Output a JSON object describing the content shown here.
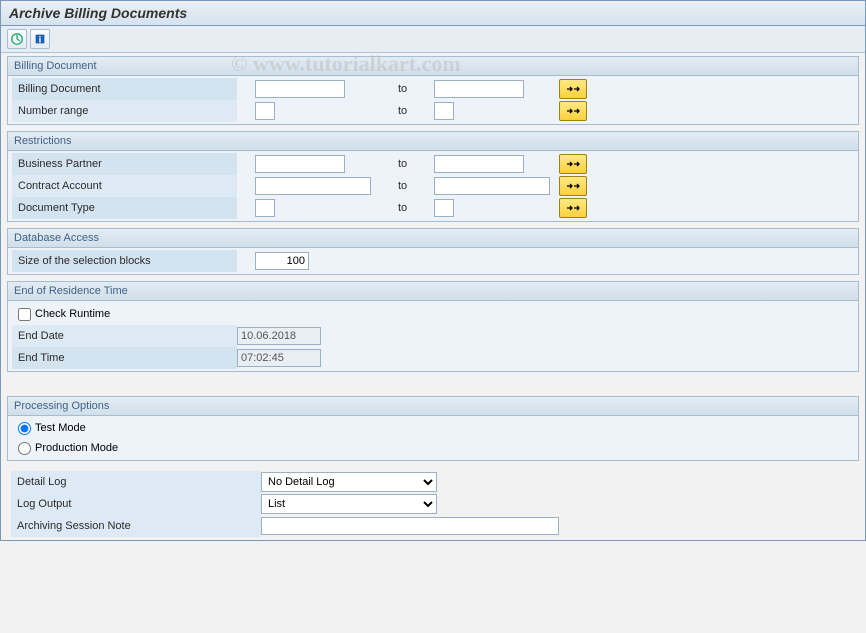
{
  "title": "Archive Billing Documents",
  "watermark": "© www.tutorialkart.com",
  "groups": {
    "billing": {
      "header": "Billing Document",
      "rows": {
        "billing_doc": {
          "label": "Billing Document",
          "from": "",
          "to_label": "to",
          "to": ""
        },
        "number_range": {
          "label": "Number range",
          "from": "",
          "to_label": "to",
          "to": ""
        }
      }
    },
    "restrictions": {
      "header": "Restrictions",
      "rows": {
        "bp": {
          "label": "Business Partner",
          "from": "",
          "to_label": "to",
          "to": ""
        },
        "ca": {
          "label": "Contract Account",
          "from": "",
          "to_label": "to",
          "to": ""
        },
        "dt": {
          "label": "Document Type",
          "from": "",
          "to_label": "to",
          "to": ""
        }
      }
    },
    "db": {
      "header": "Database Access",
      "size_label": "Size of the selection blocks",
      "size_value": "100"
    },
    "residence": {
      "header": "End of Residence Time",
      "check_label": "Check Runtime",
      "check_value": false,
      "end_date_label": "End Date",
      "end_date_value": "10.06.2018",
      "end_time_label": "End Time",
      "end_time_value": "07:02:45"
    },
    "processing": {
      "header": "Processing Options",
      "test_label": "Test Mode",
      "prod_label": "Production Mode",
      "selected": "test"
    }
  },
  "bottom": {
    "detail_log_label": "Detail Log",
    "detail_log_value": "No Detail Log",
    "log_output_label": "Log Output",
    "log_output_value": "List",
    "note_label": "Archiving Session Note",
    "note_value": ""
  }
}
